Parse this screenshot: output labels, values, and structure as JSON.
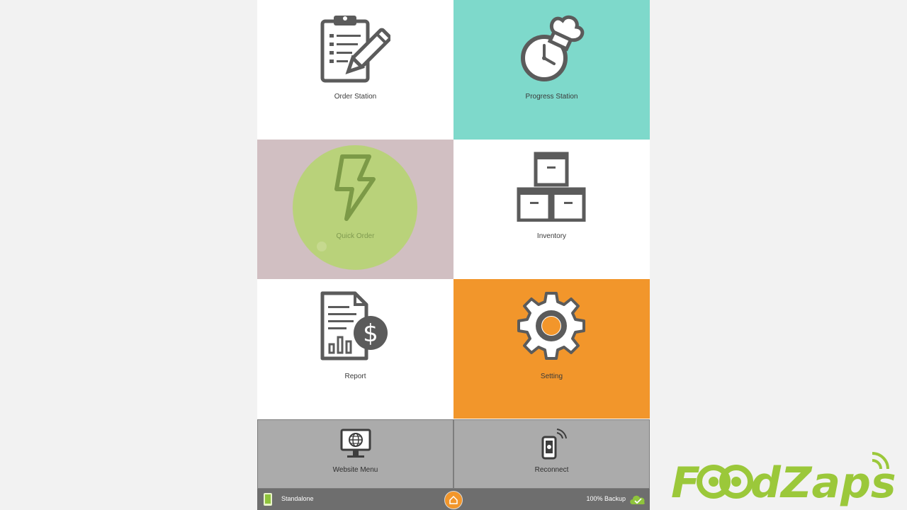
{
  "tiles": {
    "order_station": {
      "label": "Order Station",
      "bg": "#ffffff"
    },
    "progress_station": {
      "label": "Progress Station",
      "bg": "#7ed9cb"
    },
    "quick_order": {
      "label": "Quick Order",
      "bg": "#d1bfc2",
      "ripple_color": "#b9d27a"
    },
    "inventory": {
      "label": "Inventory",
      "bg": "#ffffff"
    },
    "report": {
      "label": "Report",
      "bg": "#ffffff"
    },
    "setting": {
      "label": "Setting",
      "bg": "#f2962b"
    }
  },
  "bottom": {
    "website_menu": {
      "label": "Website Menu"
    },
    "reconnect": {
      "label": "Reconnect"
    }
  },
  "status_bar": {
    "mode": "Standalone",
    "backup": "100% Backup"
  },
  "brand": {
    "name": "FoodZaps",
    "color": "#9bc83a"
  },
  "icons": [
    "clipboard-pencil-icon",
    "chef-clock-icon",
    "lightning-icon",
    "boxes-icon",
    "report-dollar-icon",
    "gear-icon",
    "monitor-globe-icon",
    "phone-signal-icon",
    "tablet-icon",
    "home-icon",
    "cloud-check-icon"
  ]
}
